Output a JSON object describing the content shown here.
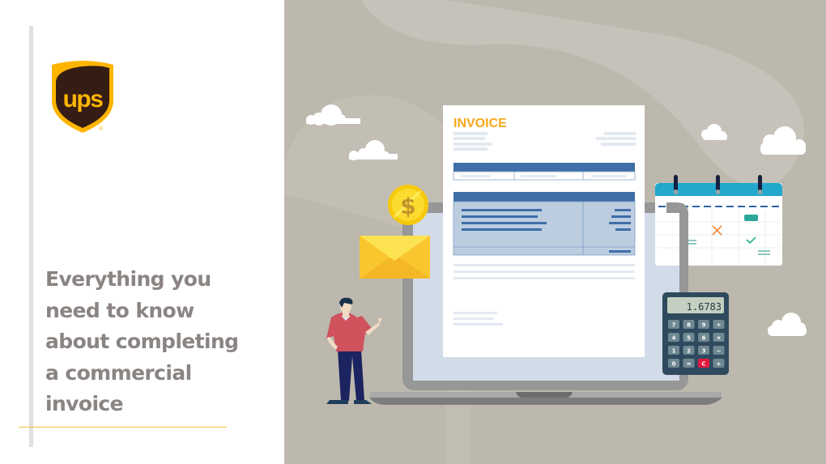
{
  "brand": {
    "logo_text": "ups",
    "registered_mark": "®",
    "colors": {
      "shield_brown": "#351c15",
      "shield_gold": "#ffb500",
      "accent_line": "#f2c439",
      "headline_gray": "#8a8482"
    }
  },
  "headline": {
    "lines": [
      "Everything you",
      "need to know",
      "about completing",
      "a commercial",
      "invoice"
    ]
  },
  "illustration": {
    "invoice_title": "INVOICE",
    "coin_symbol": "$",
    "calculator": {
      "display": "1.6783",
      "keys": [
        [
          "7",
          "8",
          "9",
          "÷"
        ],
        [
          "4",
          "5",
          "6",
          "×"
        ],
        [
          "1",
          "2",
          "3",
          "−"
        ],
        [
          "0",
          "=",
          "C",
          "+"
        ]
      ]
    },
    "calendar_marks": [
      "x-mark-icon",
      "check-mark-icon"
    ],
    "colors": {
      "background": "#bcb8ad",
      "invoice_blue": "#3f6ea8",
      "invoice_table_fill": "#bccde0",
      "invoice_title_orange": "#f7a81b",
      "calendar_teal": "#22a8cc",
      "calc_body": "#2f4a5e",
      "calc_clear": "#e3173e"
    }
  }
}
